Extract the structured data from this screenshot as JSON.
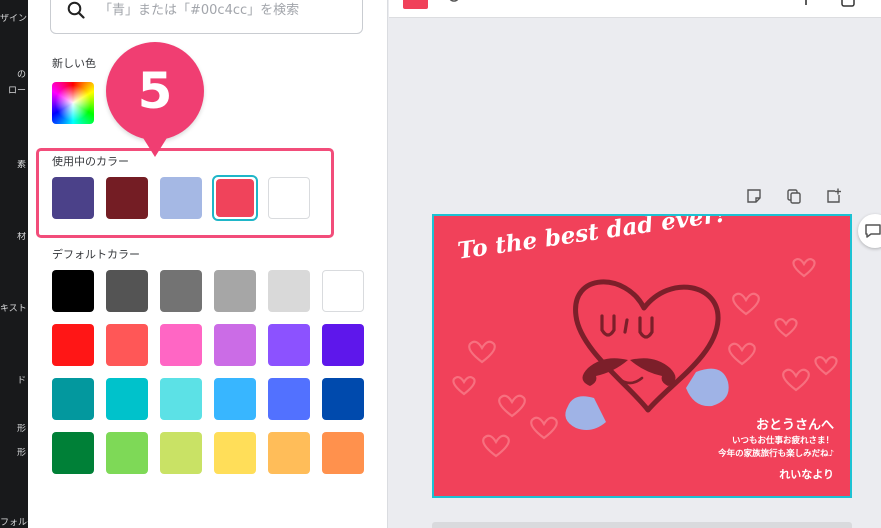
{
  "rail": {
    "items": [
      "ザイン",
      "の",
      "ロー",
      "素",
      "材",
      "キスト",
      "ド",
      "形",
      "形",
      "フォルダー"
    ]
  },
  "search": {
    "placeholder": "「青」または「#00c4cc」を検索"
  },
  "new_color": {
    "label": "新しい色"
  },
  "used_colors": {
    "label": "使用中のカラー",
    "swatches": [
      "#4b4189",
      "#741d24",
      "#a5b8e4",
      "#f0435b",
      "#ffffff"
    ],
    "selected_index": 3
  },
  "default_colors": {
    "label": "デフォルトカラー",
    "rows": [
      [
        "#000000",
        "#545454",
        "#737373",
        "#a6a6a6",
        "#d9d9d9",
        "#ffffff"
      ],
      [
        "#ff1616",
        "#ff5757",
        "#ff66c4",
        "#cb6ce6",
        "#8c52ff",
        "#5e17eb"
      ],
      [
        "#03989e",
        "#00c2cb",
        "#5ce1e6",
        "#38b6ff",
        "#5271ff",
        "#004aad"
      ],
      [
        "#008037",
        "#7ed957",
        "#c9e265",
        "#ffde59",
        "#ffbd59",
        "#ff914d"
      ]
    ]
  },
  "callout": {
    "step": "5"
  },
  "card": {
    "title": "To the best dad ever!",
    "recipient": "おとうさんへ",
    "line1": "いつもお仕事お疲れさま！",
    "line2": "今年の家族旅行も楽しみだね♪",
    "signature": "れいなより",
    "background": "#f1415a",
    "accent": "#1cc2d3"
  }
}
